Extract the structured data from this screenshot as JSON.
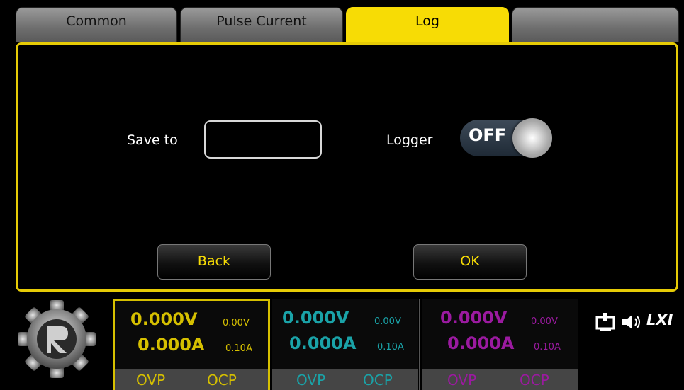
{
  "tabs": [
    {
      "label": "Common"
    },
    {
      "label": "Pulse Current"
    },
    {
      "label": "Log"
    },
    {
      "label": ""
    }
  ],
  "log": {
    "save_to_label": "Save to",
    "save_to_value": "",
    "logger_label": "Logger",
    "logger_state": "OFF",
    "back_label": "Back",
    "ok_label": "OK"
  },
  "channels": [
    {
      "voltage": "0.000V",
      "current": "0.000A",
      "set_v": "0.00V",
      "set_a": "0.10A",
      "ovp": "OVP",
      "ocp": "OCP",
      "color": "#d6c000"
    },
    {
      "voltage": "0.000V",
      "current": "0.000A",
      "set_v": "0.00V",
      "set_a": "0.10A",
      "ovp": "OVP",
      "ocp": "OCP",
      "color": "#1aa3a8"
    },
    {
      "voltage": "0.000V",
      "current": "0.000A",
      "set_v": "0.00V",
      "set_a": "0.10A",
      "ovp": "OVP",
      "ocp": "OCP",
      "color": "#9b1aa0"
    }
  ],
  "status": {
    "lxi_label": "LXI",
    "icons": [
      "network-icon",
      "speaker-icon",
      "lxi-icon"
    ]
  }
}
